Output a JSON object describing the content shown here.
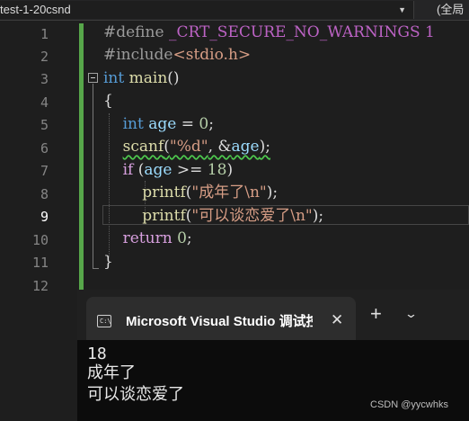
{
  "toolbar": {
    "project_dropdown": "test-1-20csnd",
    "scope_dropdown": "(全局"
  },
  "editor": {
    "line_numbers": [
      "1",
      "2",
      "3",
      "4",
      "5",
      "6",
      "7",
      "8",
      "9",
      "10",
      "11",
      "12"
    ],
    "active_line": "9",
    "code": {
      "l1_directive": "#define",
      "l1_macro": "_CRT_SECURE_NO_WARNINGS",
      "l1_value": "1",
      "l2_directive": "#include",
      "l2_header": "<stdio.h>",
      "l3_type": "int",
      "l3_name": "main",
      "l3_parens": "()",
      "l4_brace": "{",
      "l5_type": "int",
      "l5_var": "age",
      "l5_eq": "=",
      "l5_num": "0",
      "l5_semi": ";",
      "l6_fn": "scanf",
      "l6_open": "(",
      "l6_fmt": "\"%d\"",
      "l6_sep": ", &",
      "l6_var": "age",
      "l6_close": ");",
      "l7_kw": "if",
      "l7_open": "(",
      "l7_var": "age",
      "l7_op": ">=",
      "l7_num": "18",
      "l7_close": ")",
      "l8_fn": "printf",
      "l8_open": "(",
      "l8_str": "\"成年了\\n\"",
      "l8_close": ");",
      "l9_fn": "printf",
      "l9_open": "(",
      "l9_str": "\"可以谈恋爱了\\n\"",
      "l9_close": ");",
      "l10_kw": "return",
      "l10_num": "0",
      "l10_semi": ";",
      "l11_brace": "}"
    }
  },
  "console": {
    "icon": "console-icon",
    "icon_glyph": "C:\\",
    "tab_title": "Microsoft Visual Studio 调试控制台",
    "close_glyph": "✕",
    "new_tab_glyph": "+",
    "menu_glyph": "⌄",
    "output": [
      "18",
      "成年了",
      "可以谈恋爱了"
    ]
  },
  "watermark": "CSDN @yycwhks"
}
